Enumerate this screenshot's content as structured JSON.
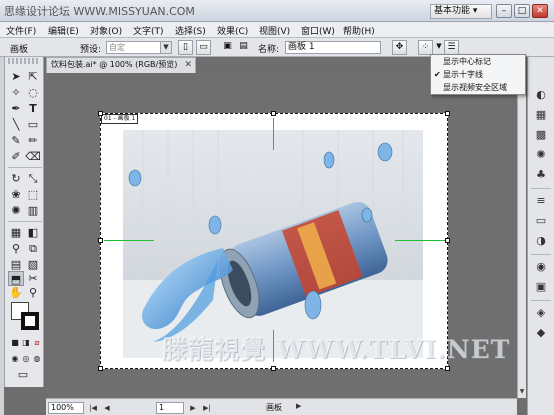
{
  "titlebar": {
    "watermark": "思缘设计论坛 WWW.MISSYUAN.COM",
    "workspace": "基本功能 ▾",
    "buttons": {
      "minimize": "–",
      "restore": "□",
      "close": "✕"
    }
  },
  "menu": [
    "文件(F)",
    "编辑(E)",
    "对象(O)",
    "文字(T)",
    "选择(S)",
    "效果(C)",
    "视图(V)",
    "窗口(W)",
    "帮助(H)"
  ],
  "control": {
    "artboard_label": "画板",
    "preset_label": "预设:",
    "preset_value": "自定",
    "name_label": "名称:",
    "name_value": "画板 1"
  },
  "document": {
    "tab_title": "饮料包装.ai* @ 100% (RGB/预览)",
    "tab_close": "✕",
    "artboard_label": "01 - 画板 1",
    "canvas_watermark": "滕龍視覺 WWW.TLVI.NET"
  },
  "status": {
    "zoom": "100%",
    "page": "1",
    "label": "画板",
    "nav": [
      "|◀",
      "◀",
      "▶",
      "▶|"
    ],
    "play": "▶"
  },
  "popup_menu": [
    {
      "label": "显示中心标记",
      "checked": false
    },
    {
      "label": "显示十字线",
      "checked": true
    },
    {
      "label": "显示视频安全区域",
      "checked": false
    }
  ],
  "colors": {
    "accent_green": "#1fbf2f",
    "canvas_bg": "#6f6f6f"
  }
}
